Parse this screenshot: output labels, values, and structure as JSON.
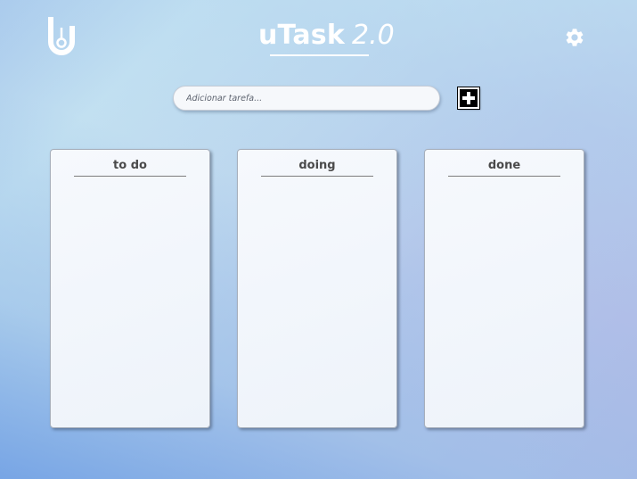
{
  "header": {
    "brand": "uTask",
    "version": "2.0",
    "logo_icon": "utask-logo-icon",
    "settings_icon": "gear-icon"
  },
  "task_form": {
    "placeholder": "Adicionar tarefa...",
    "value": "",
    "add_icon": "plus-icon"
  },
  "columns": [
    {
      "title": "to do"
    },
    {
      "title": "doing"
    },
    {
      "title": "done"
    }
  ],
  "colors": {
    "accent": "#ffffff",
    "add_button": "#000000",
    "column_bg": "#f3f6fb"
  }
}
